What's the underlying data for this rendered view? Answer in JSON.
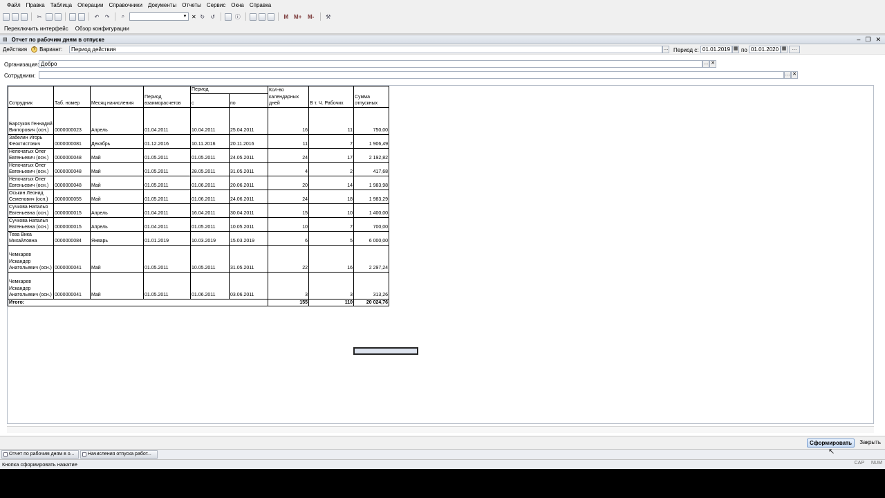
{
  "menu": [
    "Файл",
    "Правка",
    "Таблица",
    "Операции",
    "Справочники",
    "Документы",
    "Отчеты",
    "Сервис",
    "Окна",
    "Справка"
  ],
  "toolbar2": {
    "switch_interface": "Переключить интерфейс",
    "config_review": "Обзор конфигурации"
  },
  "window": {
    "title": "Отчет по рабочим дням в отпуске"
  },
  "actionsbar": {
    "actions_label": "Действия",
    "variant_label": "Вариант:",
    "variant_value": "Период действия",
    "period_from_label": "Период с:",
    "period_from": "01.01.2019",
    "period_to_label": "по",
    "period_to": "01.01.2020"
  },
  "filters": {
    "org_label": "Организация:",
    "org_value": "Добро",
    "emp_label": "Сотрудники:",
    "emp_value": ""
  },
  "report": {
    "headers": {
      "employee": "Сотрудник",
      "tab_no": "Таб. номер",
      "month": "Месяц начисления",
      "settle": "Период взаиморасчетов",
      "period": "Период",
      "from": "с",
      "to": "по",
      "cal_days": "Кол-во календарных дней",
      "work_days": "В т. Ч. Рабочих",
      "sum": "Сумма отпускных"
    },
    "rows": [
      {
        "employee": "Барсуков Геннадий Викторович (осн.)",
        "tab": "0000000023",
        "month": "Апрель",
        "settle": "01.04.2011",
        "from": "10.04.2011",
        "to": "25.04.2011",
        "cal": "16",
        "work": "11",
        "sum": "750,00"
      },
      {
        "employee": "Забелин Игорь Феоктистович",
        "tab": "0000000081",
        "month": "Декабрь",
        "settle": "01.12.2016",
        "from": "10.11.2016",
        "to": "20.11.2016",
        "cal": "11",
        "work": "7",
        "sum": "1 906,49"
      },
      {
        "employee": "Непочатых Олег Евгеньевич (осн.)",
        "tab": "0000000048",
        "month": "Май",
        "settle": "01.05.2011",
        "from": "01.05.2011",
        "to": "24.05.2011",
        "cal": "24",
        "work": "17",
        "sum": "2 192,82"
      },
      {
        "employee": "Непочатых Олег Евгеньевич (осн.)",
        "tab": "0000000048",
        "month": "Май",
        "settle": "01.05.2011",
        "from": "28.05.2011",
        "to": "31.05.2011",
        "cal": "4",
        "work": "2",
        "sum": "417,68"
      },
      {
        "employee": "Непочатых Олег Евгеньевич (осн.)",
        "tab": "0000000048",
        "month": "Май",
        "settle": "01.05.2011",
        "from": "01.06.2011",
        "to": "20.06.2011",
        "cal": "20",
        "work": "14",
        "sum": "1 983,98"
      },
      {
        "employee": "Оськин Леонид Семенович (осн.)",
        "tab": "0000000055",
        "month": "Май",
        "settle": "01.05.2011",
        "from": "01.06.2011",
        "to": "24.06.2011",
        "cal": "24",
        "work": "18",
        "sum": "1 983,29"
      },
      {
        "employee": "Сучкова Наталья Евгеньевна (осн.)",
        "tab": "0000000015",
        "month": "Апрель",
        "settle": "01.04.2011",
        "from": "16.04.2011",
        "to": "30.04.2011",
        "cal": "15",
        "work": "10",
        "sum": "1 400,00"
      },
      {
        "employee": "Сучкова Наталья Евгеньевна (осн.)",
        "tab": "0000000015",
        "month": "Апрель",
        "settle": "01.04.2011",
        "from": "01.05.2011",
        "to": "10.05.2011",
        "cal": "10",
        "work": "7",
        "sum": "700,00"
      },
      {
        "employee": "Тева Вика Михайловна",
        "tab": "0000000084",
        "month": "Январь",
        "settle": "01.01.2019",
        "from": "10.03.2019",
        "to": "15.03.2019",
        "cal": "6",
        "work": "5",
        "sum": "6 000,00"
      },
      {
        "employee": "Чемкарев Искандер Анатольевич (осн.)",
        "tab": "0000000041",
        "month": "Май",
        "settle": "01.05.2011",
        "from": "10.05.2011",
        "to": "31.05.2011",
        "cal": "22",
        "work": "16",
        "sum": "2 297,24"
      },
      {
        "employee": "Чемкарев Искандер Анатольевич (осн.)",
        "tab": "0000000041",
        "month": "Май",
        "settle": "01.05.2011",
        "from": "01.06.2011",
        "to": "03.06.2011",
        "cal": "3",
        "work": "3",
        "sum": "313,26"
      }
    ],
    "total": {
      "label": "Итого:",
      "cal": "155",
      "work": "110",
      "sum": "20 024,76"
    }
  },
  "buttons": {
    "generate": "Сформировать",
    "close": "Закрыть"
  },
  "tasks": [
    "Отчет по рабочим дням в о...",
    "Начисления отпуска работ..."
  ],
  "status": {
    "text": "Кнопка сформировать нажатие",
    "cap": "CAP",
    "num": "NUM"
  }
}
